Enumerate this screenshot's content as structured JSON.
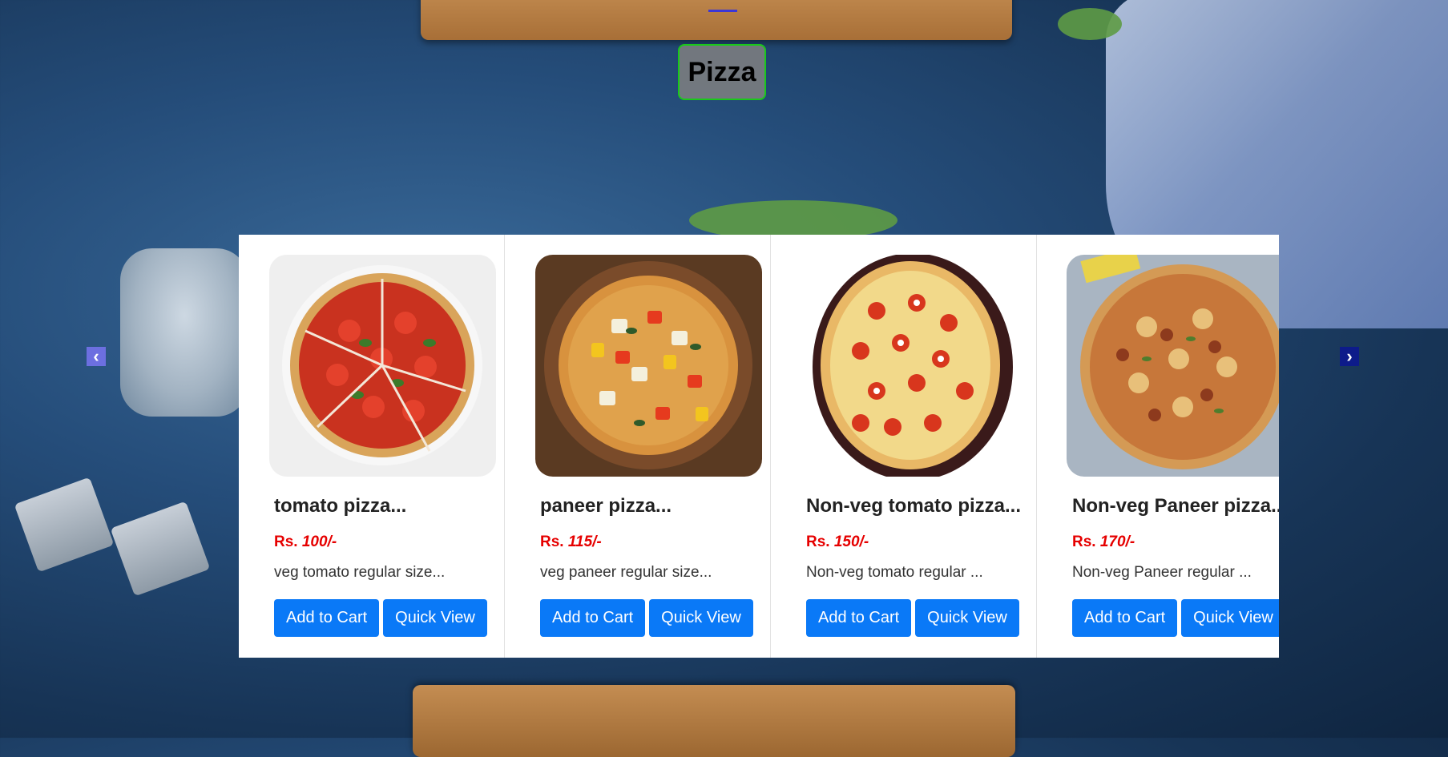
{
  "header": {
    "title": "Pizza"
  },
  "carousel": {
    "prev_icon": "chevron-left-icon",
    "next_icon": "chevron-right-icon",
    "products": [
      {
        "name": "tomato pizza...",
        "currency": "Rs.",
        "price": "100/-",
        "description": "veg tomato regular size...",
        "add_label": "Add to Cart",
        "view_label": "Quick View"
      },
      {
        "name": "paneer pizza...",
        "currency": "Rs.",
        "price": "115/-",
        "description": "veg paneer regular size...",
        "add_label": "Add to Cart",
        "view_label": "Quick View"
      },
      {
        "name": "Non-veg tomato pizza...",
        "currency": "Rs.",
        "price": "150/-",
        "description": "Non-veg tomato regular ...",
        "add_label": "Add to Cart",
        "view_label": "Quick View"
      },
      {
        "name": "Non-veg Paneer pizza...",
        "currency": "Rs.",
        "price": "170/-",
        "description": "Non-veg Paneer regular ...",
        "add_label": "Add to Cart",
        "view_label": "Quick View"
      }
    ]
  },
  "colors": {
    "button": "#0a79f7",
    "price": "#e60000",
    "title_border": "#19c919"
  }
}
